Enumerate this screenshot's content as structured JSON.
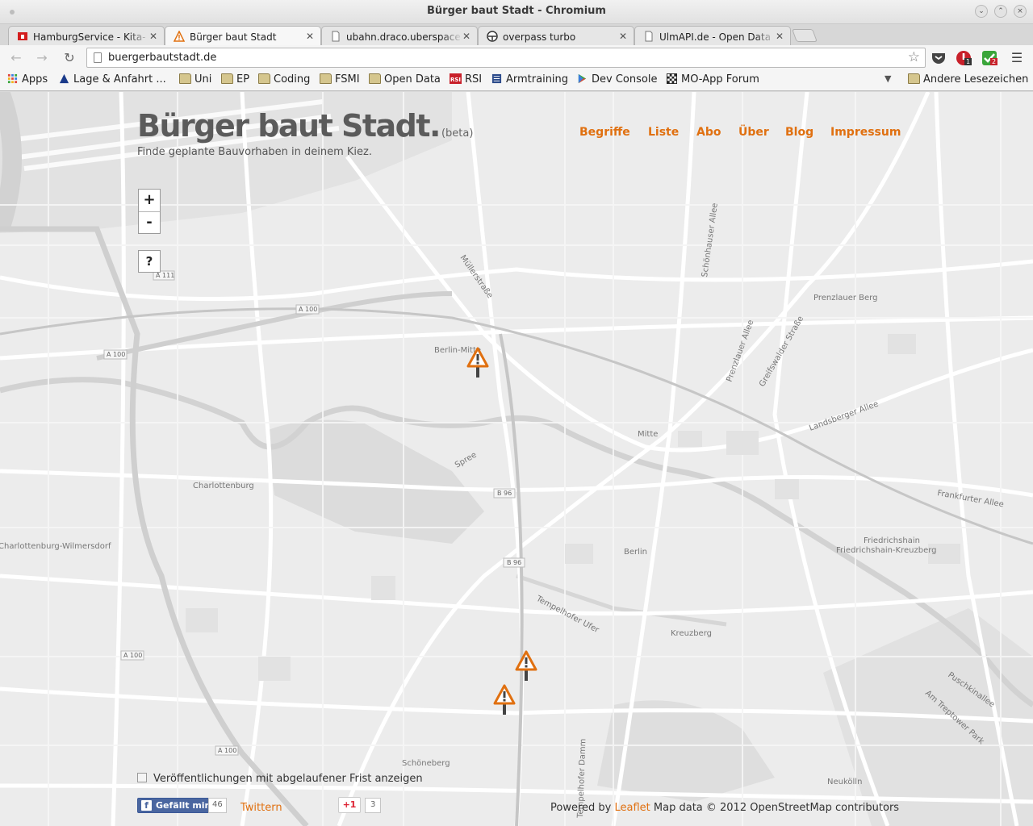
{
  "window": {
    "title": "Bürger baut Stadt - Chromium"
  },
  "tabs": [
    {
      "label": "HamburgService - Kita-",
      "icon": "hamburg-flag-icon",
      "active": false
    },
    {
      "label": "Bürger baut Stadt",
      "icon": "warning-icon",
      "active": true
    },
    {
      "label": "ubahn.draco.uberspace",
      "icon": "page-icon",
      "active": false
    },
    {
      "label": "overpass turbo",
      "icon": "overpass-icon",
      "active": false
    },
    {
      "label": "UlmAPI.de - Open Data",
      "icon": "page-icon",
      "active": false
    }
  ],
  "address_bar": {
    "url": "buergerbautstadt.de"
  },
  "extensions": {
    "badge_1": "1",
    "badge_2": "2"
  },
  "bookmarks": {
    "items": [
      "Apps",
      "Lage & Anfahrt ...",
      "Uni",
      "EP",
      "Coding",
      "FSMI",
      "Open Data",
      "RSI",
      "Armtraining",
      "Dev Console",
      "MO-App Forum"
    ],
    "other": "Andere Lesezeichen"
  },
  "site": {
    "title": "Bürger baut Stadt.",
    "beta": "(beta)",
    "tagline": "Finde geplante Bauvorhaben in deinem Kiez.",
    "nav": [
      "Begriffe",
      "Liste",
      "Abo",
      "Über",
      "Blog",
      "Impressum"
    ]
  },
  "map": {
    "zoom_in": "+",
    "zoom_out": "-",
    "help": "?",
    "labels": [
      "Berlin-Mitte",
      "Mitte",
      "Charlottenburg",
      "Charlottenburg-Wilmersdorf",
      "Prenzlauer Berg",
      "Berlin",
      "Kreuzberg",
      "Friedrichshain",
      "Friedrichshain-Kreuzberg",
      "Schöneberg",
      "Neukölln",
      "Müllerstraße",
      "Schönhauser Allee",
      "Prenzlauer Allee",
      "Greifswalder Straße",
      "Landsberger Allee",
      "Frankfurter Allee",
      "Spree",
      "Tempelhofer Ufer",
      "Tempelhofer Damm",
      "Puschkinallee",
      "Am Treptower Park",
      "A 100",
      "A 111",
      "B 96"
    ]
  },
  "footer": {
    "expired_label": "Veröffentlichungen mit abgelaufener Frist anzeigen",
    "fb_like": "Gefällt mir",
    "fb_count": "46",
    "twitter": "Twittern",
    "gplus": "+1",
    "gplus_count": "3",
    "attribution_prefix": "Powered by",
    "attribution_link": "Leaflet",
    "attribution_suffix": "Map data © 2012 OpenStreetMap contributors"
  },
  "colors": {
    "accent": "#e07010",
    "map_bg": "#ececec",
    "road": "#ffffff",
    "water": "#d2d2d2"
  }
}
